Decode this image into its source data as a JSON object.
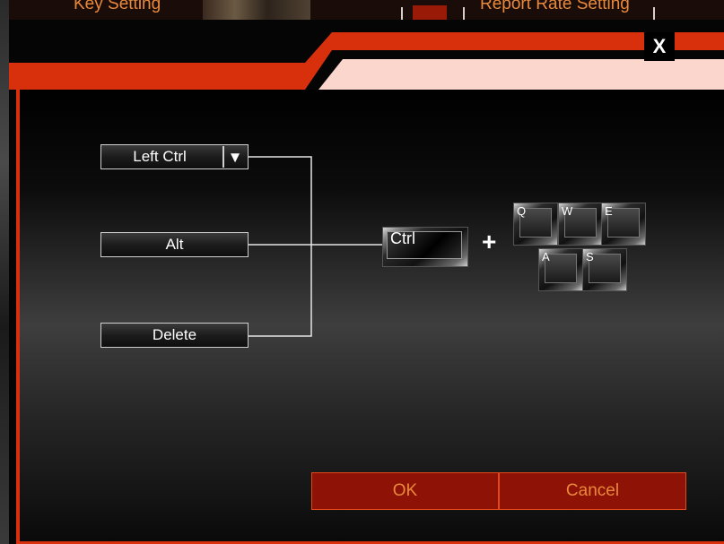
{
  "background_tabs": {
    "left": "Key Setting",
    "right": "Report Rate Setting"
  },
  "dialog": {
    "close_label": "X"
  },
  "modifiers": {
    "dropdown_value": "Left Ctrl",
    "dropdown_arrow": "▼",
    "second": "Alt",
    "third": "Delete"
  },
  "preview": {
    "modifier_key": "Ctrl",
    "plus": "+",
    "keys": [
      "Q",
      "W",
      "E",
      "A",
      "S"
    ]
  },
  "buttons": {
    "ok": "OK",
    "cancel": "Cancel"
  },
  "colors": {
    "accent": "#d8300c",
    "button_bg": "#8e1206",
    "button_text": "#e8893c",
    "header_pink": "#fbd6cc"
  }
}
